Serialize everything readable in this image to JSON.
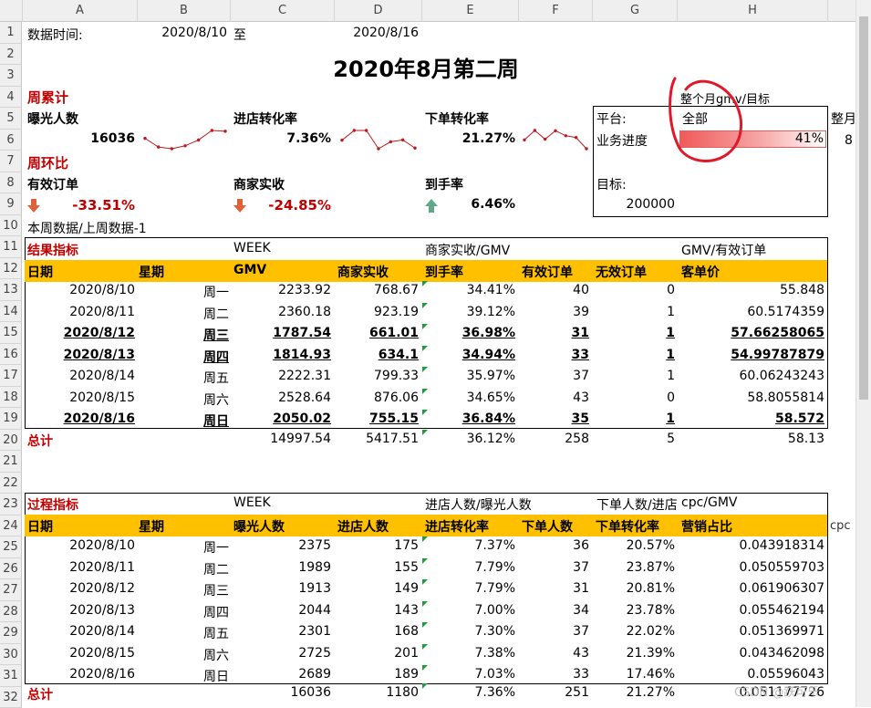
{
  "columns": [
    "A",
    "B",
    "C",
    "D",
    "E",
    "F",
    "G",
    "H"
  ],
  "rows": [
    "1",
    "2",
    "3",
    "4",
    "5",
    "6",
    "7",
    "8",
    "9",
    "10",
    "11",
    "12",
    "13",
    "14",
    "15",
    "16",
    "17",
    "18",
    "19",
    "20",
    "21",
    "22",
    "23",
    "24",
    "25",
    "26",
    "27",
    "28",
    "29",
    "30",
    "31",
    "32"
  ],
  "header": {
    "date_label": "数据时间:",
    "date_start": "2020/8/10",
    "to": "至",
    "date_end": "2020/8/16",
    "title": "2020年8月第二周"
  },
  "summary": {
    "cumulative_label": "周累计",
    "exposure_label": "曝光人数",
    "exposure_value": "16036",
    "store_rate_label": "进店转化率",
    "store_rate_value": "7.36%",
    "order_rate_label": "下单转化率",
    "order_rate_value": "21.27%",
    "wow_label": "周环比",
    "valid_orders_label": "有效订单",
    "valid_orders_value": "-33.51%",
    "receipts_label": "商家实收",
    "receipts_value": "-24.85%",
    "net_rate_label": "到手率",
    "net_rate_value": "6.46%",
    "note": "本周数据/上周数据-1"
  },
  "panel": {
    "caption": "整个月gmv/目标",
    "platform_label": "平台:",
    "platform_value": "全部",
    "progress_label": "业务进度",
    "progress_value": "41%",
    "progress_fraction": 0.41,
    "target_label": "目标:",
    "target_value": "200000",
    "clip_text": "整月",
    "clip_digit": "8"
  },
  "sparklines": {
    "exposure": [
      2375,
      1989,
      1913,
      2044,
      2301,
      2725,
      2689
    ],
    "store_rate": [
      7.37,
      7.79,
      7.79,
      7.0,
      7.3,
      7.38,
      7.03
    ],
    "order_rate": [
      20.57,
      23.87,
      20.81,
      23.78,
      22.02,
      21.39,
      17.46
    ]
  },
  "result": {
    "section_label": "结果指标",
    "notes": [
      "WEEK",
      "商家实收/GMV",
      "GMV/有效订单"
    ],
    "headers": [
      "日期",
      "星期",
      "GMV",
      "商家实收",
      "到手率",
      "有效订单",
      "无效订单",
      "客单价"
    ],
    "rows": [
      {
        "cells": [
          "2020/8/10",
          "周一",
          "2233.92",
          "768.67",
          "34.41%",
          "40",
          "0",
          "55.848"
        ],
        "bold": false
      },
      {
        "cells": [
          "2020/8/11",
          "周二",
          "2360.18",
          "923.19",
          "39.12%",
          "39",
          "1",
          "60.5174359"
        ],
        "bold": false
      },
      {
        "cells": [
          "2020/8/12",
          "周三",
          "1787.54",
          "661.01",
          "36.98%",
          "31",
          "1",
          "57.66258065"
        ],
        "bold": true
      },
      {
        "cells": [
          "2020/8/13",
          "周四",
          "1814.93",
          "634.1",
          "34.94%",
          "33",
          "1",
          "54.99787879"
        ],
        "bold": true
      },
      {
        "cells": [
          "2020/8/14",
          "周五",
          "2222.31",
          "799.33",
          "35.97%",
          "37",
          "1",
          "60.06243243"
        ],
        "bold": false
      },
      {
        "cells": [
          "2020/8/15",
          "周六",
          "2528.64",
          "876.06",
          "34.65%",
          "43",
          "0",
          "58.8055814"
        ],
        "bold": false
      },
      {
        "cells": [
          "2020/8/16",
          "周日",
          "2050.02",
          "755.15",
          "36.84%",
          "35",
          "1",
          "58.572"
        ],
        "bold": true
      }
    ],
    "total": [
      "总计",
      "",
      "14997.54",
      "5417.51",
      "36.12%",
      "258",
      "5",
      "58.13"
    ]
  },
  "process": {
    "section_label": "过程指标",
    "notes": [
      "WEEK",
      "进店人数/曝光人数",
      "下单人数/进店",
      "cpc/GMV"
    ],
    "clip_text": "cpc",
    "headers": [
      "日期",
      "星期",
      "曝光人数",
      "进店人数",
      "进店转化率",
      "下单人数",
      "下单转化率",
      "营销占比"
    ],
    "rows": [
      [
        "2020/8/10",
        "周一",
        "2375",
        "175",
        "7.37%",
        "36",
        "20.57%",
        "0.043918314"
      ],
      [
        "2020/8/11",
        "周二",
        "1989",
        "155",
        "7.79%",
        "37",
        "23.87%",
        "0.050559703"
      ],
      [
        "2020/8/12",
        "周三",
        "1913",
        "149",
        "7.79%",
        "31",
        "20.81%",
        "0.061906307"
      ],
      [
        "2020/8/13",
        "周四",
        "2044",
        "143",
        "7.00%",
        "34",
        "23.78%",
        "0.055462194"
      ],
      [
        "2020/8/14",
        "周五",
        "2301",
        "168",
        "7.30%",
        "37",
        "22.02%",
        "0.051369971"
      ],
      [
        "2020/8/15",
        "周六",
        "2725",
        "201",
        "7.38%",
        "43",
        "21.39%",
        "0.043462098"
      ],
      [
        "2020/8/16",
        "周日",
        "2689",
        "189",
        "7.03%",
        "33",
        "17.46%",
        "0.05596043"
      ]
    ],
    "total": [
      "总计",
      "",
      "16036",
      "1180",
      "7.36%",
      "251",
      "21.27%",
      "0.051177726"
    ]
  },
  "watermark": "CSDN @跃可乐",
  "colors": {
    "header_band": "#ffc000",
    "accent_red": "#c00000",
    "down_arrow": "#e0603a",
    "up_arrow": "#5fa98a",
    "annotation": "#e0182a"
  }
}
